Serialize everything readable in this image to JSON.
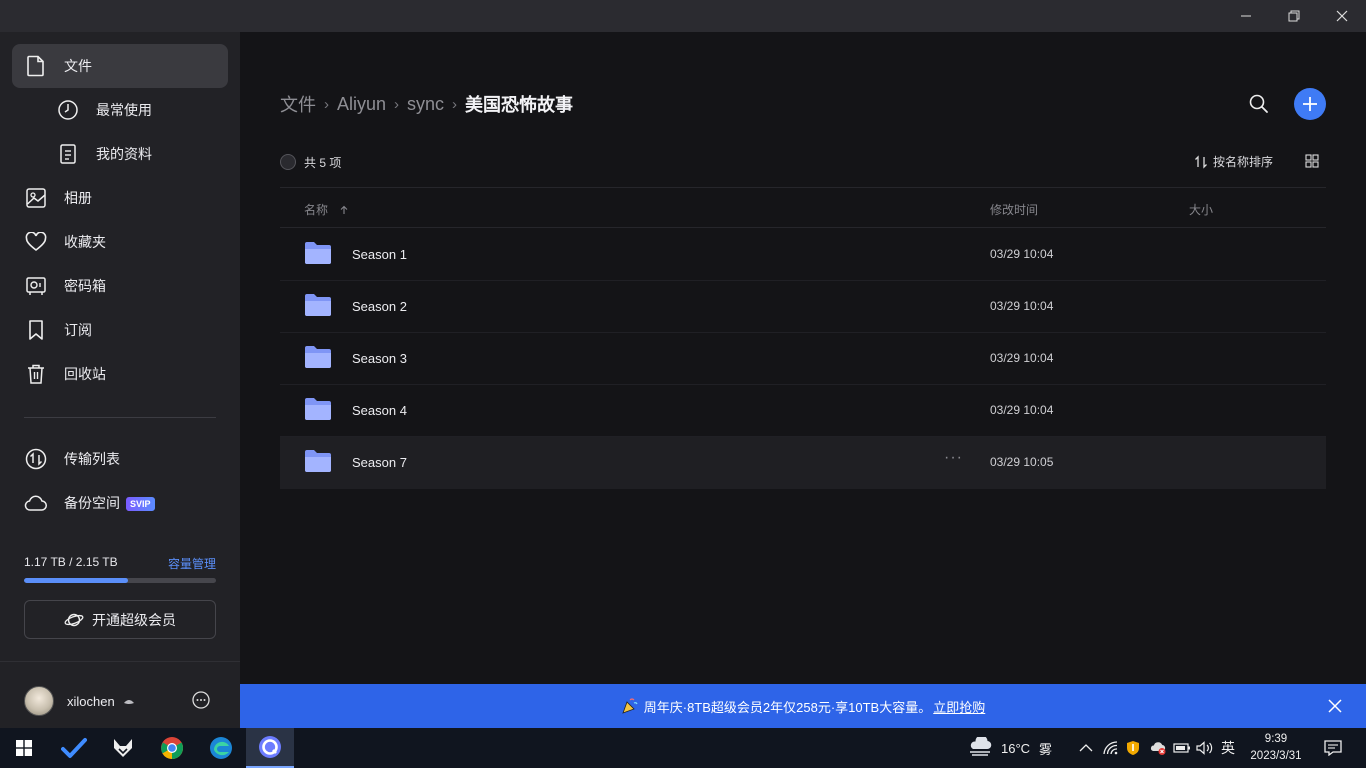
{
  "sidebar": {
    "items": [
      {
        "label": "文件"
      },
      {
        "label": "最常使用"
      },
      {
        "label": "我的资料"
      },
      {
        "label": "相册"
      },
      {
        "label": "收藏夹"
      },
      {
        "label": "密码箱"
      },
      {
        "label": "订阅"
      },
      {
        "label": "回收站"
      },
      {
        "label": "传输列表"
      },
      {
        "label": "备份空间",
        "badge": "SVIP"
      }
    ],
    "storage": {
      "text": "1.17 TB / 2.15 TB",
      "manage": "容量管理",
      "used_fraction": 0.544
    },
    "upgrade_label": "开通超级会员",
    "user": {
      "name": "xilochen"
    }
  },
  "main": {
    "breadcrumb": [
      "文件",
      "Aliyun",
      "sync",
      "美国恐怖故事"
    ],
    "count_text": "共 5 项",
    "sort_label": "按名称排序",
    "columns": {
      "name": "名称",
      "modified": "修改时间",
      "size": "大小"
    },
    "files": [
      {
        "name": "Season 1",
        "modified": "03/29 10:04",
        "size": ""
      },
      {
        "name": "Season 2",
        "modified": "03/29 10:04",
        "size": ""
      },
      {
        "name": "Season 3",
        "modified": "03/29 10:04",
        "size": ""
      },
      {
        "name": "Season 4",
        "modified": "03/29 10:04",
        "size": ""
      },
      {
        "name": "Season 7",
        "modified": "03/29 10:05",
        "size": ""
      }
    ],
    "row_more": "···"
  },
  "banner": {
    "text": "周年庆·8TB超级会员2年仅258元·享10TB大容量。",
    "link": "立即抢购"
  },
  "taskbar": {
    "weather": {
      "temp": "16°C",
      "condition": "雾"
    },
    "ime": "英",
    "time": "9:39",
    "date": "2023/3/31"
  },
  "colors": {
    "accent": "#3f7bf5",
    "banner": "#2e64e8",
    "folder": "#8aa3ff"
  }
}
